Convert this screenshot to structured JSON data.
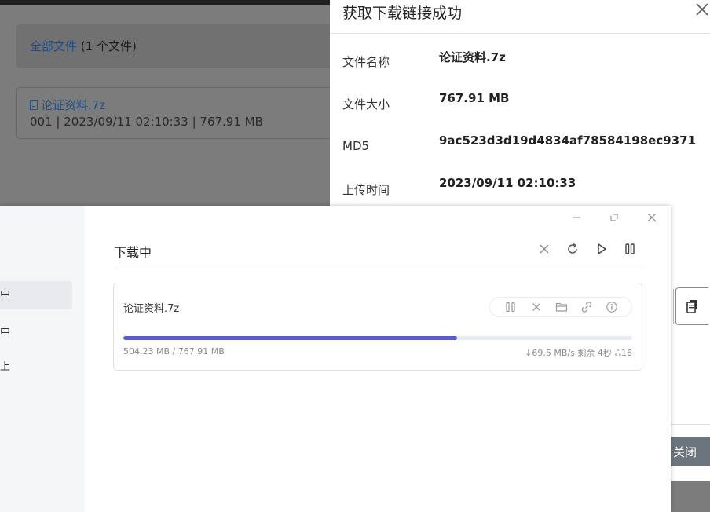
{
  "background_page": {
    "breadcrumb_link": "全部文件",
    "breadcrumb_count": "(1 个文件)",
    "file_name": "论证资料.7z",
    "file_meta": "001 | 2023/09/11 02:10:33 | 767.91 MB"
  },
  "panel": {
    "title": "获取下载链接成功",
    "rows": [
      {
        "label": "文件名称",
        "value": "论证资料.7z"
      },
      {
        "label": "文件大小",
        "value": "767.91 MB"
      },
      {
        "label": "MD5",
        "value": "9ac523d3d19d4834af78584198ec9371"
      },
      {
        "label": "上传时间",
        "value": "2023/09/11 02:10:33"
      }
    ],
    "close_label": "关闭"
  },
  "download_manager": {
    "sidebar": [
      "中",
      "中",
      "上"
    ],
    "section_title": "下载中",
    "task": {
      "name": "论证资料.7z",
      "progress": 0.656,
      "size_text": "504.23 MB / 767.91 MB",
      "stats_text": "↓69.5 MB/s  剩余 4秒  ஃ16"
    }
  },
  "colors": {
    "accent": "#5a5bd6",
    "close_button": "#6c757d",
    "link": "#1d4f8a"
  }
}
